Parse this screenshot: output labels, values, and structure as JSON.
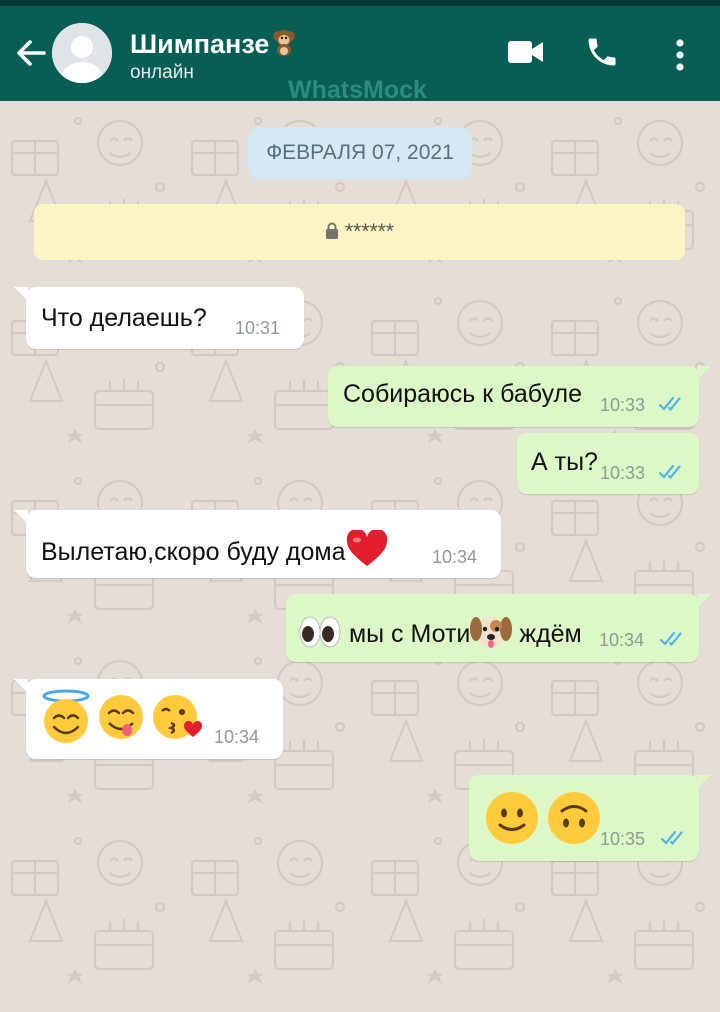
{
  "header": {
    "contact_name": "Шимпанзе",
    "contact_emoji": "monkey-emoji",
    "status": "онлайн",
    "watermark": "WhatsMock",
    "back_icon": "back-arrow-icon",
    "video_icon": "video-call-icon",
    "call_icon": "phone-call-icon",
    "menu_icon": "more-vert-icon"
  },
  "chat": {
    "date": "ФЕВРАЛЯ 07, 2021",
    "encryption_note": "******",
    "messages": [
      {
        "direction": "in",
        "text": "Что делаешь?",
        "time": "10:31"
      },
      {
        "direction": "out",
        "text": "Собираюсь к бабуле",
        "time": "10:33",
        "read": true
      },
      {
        "direction": "out",
        "text": "А ты?",
        "time": "10:33",
        "read": true
      },
      {
        "direction": "in",
        "text": "Вылетаю,скоро буду дома",
        "emoji_after": "red-heart-emoji",
        "time": "10:34"
      },
      {
        "direction": "out",
        "emoji_before": "eyes-emoji",
        "text_a": "мы с Моти",
        "emoji_mid": "dog-face-emoji",
        "text_b": "ждём",
        "time": "10:34",
        "read": true
      },
      {
        "direction": "in",
        "emojis": [
          "smiling-face-with-halo-emoji",
          "face-savoring-food-emoji",
          "face-blowing-kiss-emoji"
        ],
        "time": "10:34"
      },
      {
        "direction": "out",
        "emojis": [
          "slightly-smiling-face-emoji",
          "upside-down-face-emoji"
        ],
        "time": "10:35",
        "read": true
      }
    ]
  },
  "colors": {
    "header": "#075e54",
    "chat_bg": "#e5ded6",
    "outgoing_bubble": "#dcf8c6",
    "incoming_bubble": "#ffffff",
    "read_ticks": "#4fb6ec"
  }
}
